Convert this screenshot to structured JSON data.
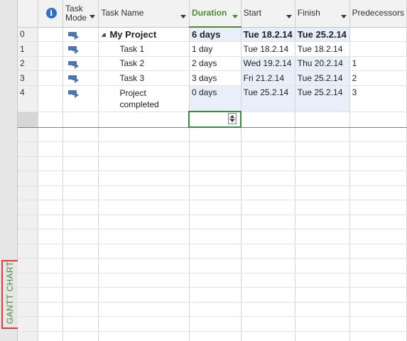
{
  "viewbar": {
    "label": "GANTT CHART"
  },
  "columns": {
    "info_icon": "information-icon",
    "task_mode": "Task Mode",
    "task_name": "Task Name",
    "duration": "Duration",
    "start": "Start",
    "finish": "Finish",
    "predecessors": "Predecessors"
  },
  "rows": [
    {
      "id": "0",
      "name": "My Project",
      "duration": "6 days",
      "start": "Tue 18.2.14",
      "finish": "Tue 25.2.14",
      "predecessors": ""
    },
    {
      "id": "1",
      "name": "Task 1",
      "duration": "1 day",
      "start": "Tue 18.2.14",
      "finish": "Tue 18.2.14",
      "predecessors": ""
    },
    {
      "id": "2",
      "name": "Task 2",
      "duration": "2 days",
      "start": "Wed 19.2.14",
      "finish": "Thu 20.2.14",
      "predecessors": "1"
    },
    {
      "id": "3",
      "name": "Task 3",
      "duration": "3 days",
      "start": "Fri 21.2.14",
      "finish": "Tue 25.2.14",
      "predecessors": "2"
    },
    {
      "id": "4",
      "name": "Project completed",
      "duration": "0 days",
      "start": "Tue 25.2.14",
      "finish": "Tue 25.2.14",
      "predecessors": "3"
    }
  ],
  "colors": {
    "accent_green": "#4e8a32",
    "task_mode_icon": "#4f76ae",
    "highlight_box": "#e03a3a"
  }
}
